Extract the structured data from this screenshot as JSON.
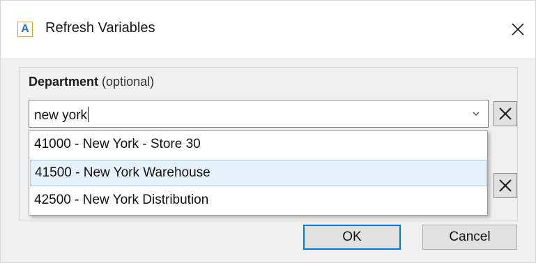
{
  "window": {
    "title": "Refresh Variables",
    "app_icon_letter": "A",
    "close_glyph": "✕"
  },
  "variables": [
    {
      "name": "Department",
      "qualifier": "(optional)",
      "value": "new york",
      "clear_icon": "clear-x-icon"
    }
  ],
  "dropdown": {
    "items": [
      {
        "label": "41000 - New York - Store 30",
        "selected": false
      },
      {
        "label": "41500 - New York Warehouse",
        "selected": true
      },
      {
        "label": "42500 - New York Distribution",
        "selected": false
      }
    ]
  },
  "buttons": {
    "ok": "OK",
    "cancel": "Cancel"
  },
  "colors": {
    "accent": "#0078d7",
    "selection_bg": "#e5f1fb",
    "selection_border": "#99c9ef",
    "icon_border": "#e5a323",
    "icon_letter": "#2a6fd6"
  }
}
